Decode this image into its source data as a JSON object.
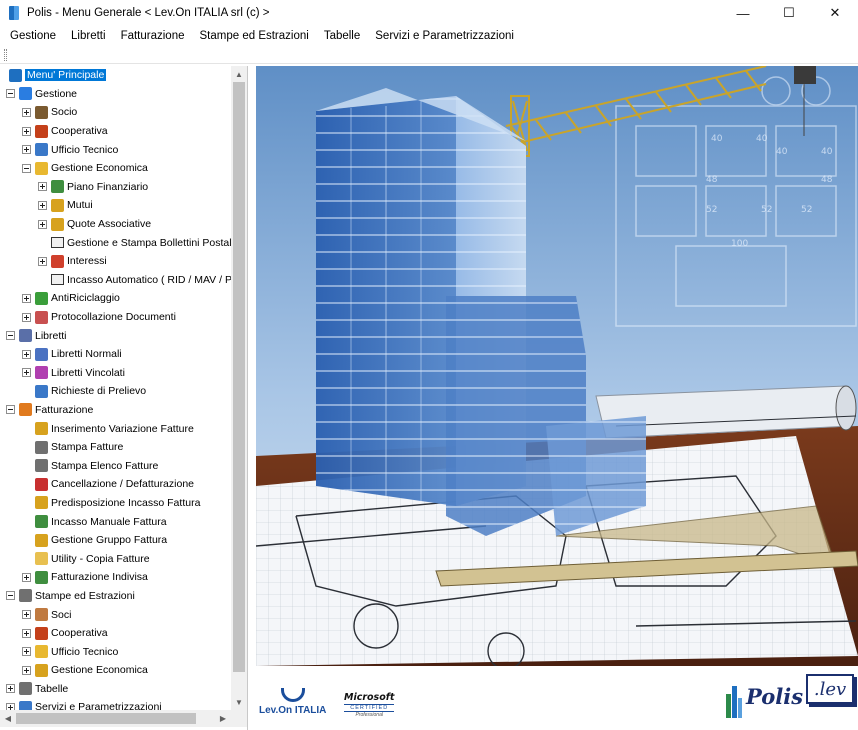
{
  "window": {
    "title": "Polis - Menu Generale  < Lev.On ITALIA srl  (c) >",
    "minimize_glyph": "—",
    "maximize_glyph": "☐",
    "close_glyph": "✕"
  },
  "menubar": {
    "items": [
      "Gestione",
      "Libretti",
      "Fatturazione",
      "Stampe ed Estrazioni",
      "Tabelle",
      "Servizi e Parametrizzazioni"
    ]
  },
  "tree": {
    "nodes": [
      {
        "label": "Menu' Principale",
        "icon": "polis-icon",
        "color": "#1e6fc0"
      },
      {
        "label": "Gestione",
        "icon": "gestione-icon",
        "color": "#2a7de1"
      },
      {
        "label": "Socio",
        "icon": "users-icon",
        "color": "#7a5a30"
      },
      {
        "label": "Cooperativa",
        "icon": "gear-icon",
        "color": "#c4401a"
      },
      {
        "label": "Ufficio Tecnico",
        "icon": "computer-icon",
        "color": "#3a78c8"
      },
      {
        "label": "Gestione Economica",
        "icon": "folder-open-icon",
        "color": "#e8b830"
      },
      {
        "label": "Piano Finanziario",
        "icon": "chart-icon",
        "color": "#3f8e3f"
      },
      {
        "label": "Mutui",
        "icon": "coins-icon",
        "color": "#d7a21e"
      },
      {
        "label": "Quote Associative",
        "icon": "handshake-icon",
        "color": "#d7a21e"
      },
      {
        "label": "Gestione e Stampa Bollettini Postali",
        "icon": "form-icon",
        "color": "#f0f0f0"
      },
      {
        "label": "Interessi",
        "icon": "percent-icon",
        "color": "#d0402c"
      },
      {
        "label": "Incasso Automatico ( RID / MAV / Poste )",
        "icon": "form-icon",
        "color": "#f0f0f0"
      },
      {
        "label": "AntiRiciclaggio",
        "icon": "recycle-icon",
        "color": "#3a9e3a"
      },
      {
        "label": "Protocollazione Documenti",
        "icon": "stamp-icon",
        "color": "#c85050"
      },
      {
        "label": "Libretti",
        "icon": "libretti-icon",
        "color": "#5a6fa8"
      },
      {
        "label": "Libretti Normali",
        "icon": "passbook-icon",
        "color": "#4b72c2"
      },
      {
        "label": "Libretti Vincolati",
        "icon": "passbook-locked-icon",
        "color": "#b03fb0"
      },
      {
        "label": "Richieste di Prelievo",
        "icon": "withdraw-icon",
        "color": "#3a78c8"
      },
      {
        "label": "Fatturazione",
        "icon": "invoice-icon",
        "color": "#e07a1e"
      },
      {
        "label": "Inserimento Variazione Fatture",
        "icon": "edit-invoice-icon",
        "color": "#d7a21e"
      },
      {
        "label": "Stampa Fatture",
        "icon": "printer-icon",
        "color": "#707070"
      },
      {
        "label": "Stampa Elenco Fatture",
        "icon": "printer-list-icon",
        "color": "#707070"
      },
      {
        "label": "Cancellazione / Defatturazione",
        "icon": "cancel-invoice-icon",
        "color": "#c83030"
      },
      {
        "label": "Predisposizione Incasso Fattura",
        "icon": "money-icon",
        "color": "#d7a21e"
      },
      {
        "label": "Incasso Manuale Fattura",
        "icon": "cash-icon",
        "color": "#3f8e3f"
      },
      {
        "label": "Gestione Gruppo Fattura",
        "icon": "group-invoice-icon",
        "color": "#d7a21e"
      },
      {
        "label": "Utility  - Copia Fatture",
        "icon": "copy-icon",
        "color": "#e8c050"
      },
      {
        "label": "Fatturazione Indivisa",
        "icon": "split-invoice-icon",
        "color": "#3f8e3f"
      },
      {
        "label": "Stampe ed Estrazioni",
        "icon": "print-export-icon",
        "color": "#707070"
      },
      {
        "label": "Soci",
        "icon": "person-icon",
        "color": "#c07a40"
      },
      {
        "label": "Cooperativa",
        "icon": "gear-icon",
        "color": "#c4401a"
      },
      {
        "label": "Ufficio Tecnico",
        "icon": "helmet-icon",
        "color": "#e8b830"
      },
      {
        "label": "Gestione Economica",
        "icon": "coins-icon",
        "color": "#d7a21e"
      },
      {
        "label": "Tabelle",
        "icon": "table-icon",
        "color": "#707070"
      },
      {
        "label": "Servizi e Parametrizzazioni",
        "icon": "services-icon",
        "color": "#3a78c8"
      }
    ]
  },
  "scrollbars": {
    "up_glyph": "▲",
    "down_glyph": "▼",
    "left_glyph": "◀",
    "right_glyph": "▶"
  },
  "logos": {
    "levon": "Lev.On ITALIA",
    "microsoft": "Microsoft",
    "certified": "CERTIFIED",
    "professional": "Professional",
    "polis": "Polis",
    "lev": ".lev"
  },
  "blueprint_numbers": [
    "40",
    "40",
    "40",
    "40",
    "48",
    "48",
    "52",
    "52",
    "100",
    "52"
  ]
}
